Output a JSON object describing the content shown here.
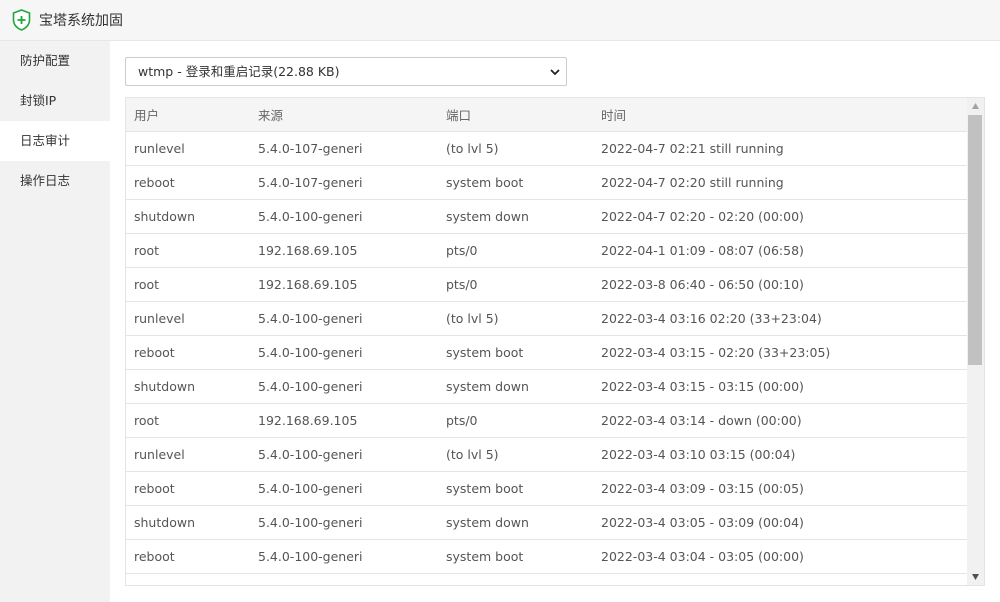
{
  "app": {
    "title": "宝塔系统加固",
    "icon": "shield-plus-icon",
    "accent": "#20a53a"
  },
  "sidebar": {
    "items": [
      {
        "label": "防护配置",
        "active": false
      },
      {
        "label": "封锁IP",
        "active": false
      },
      {
        "label": "日志审计",
        "active": true
      },
      {
        "label": "操作日志",
        "active": false
      }
    ]
  },
  "log_select": {
    "value": "wtmp - 登录和重启记录(22.88 KB)"
  },
  "table": {
    "headers": [
      "用户",
      "来源",
      "端口",
      "时间"
    ],
    "rows": [
      [
        "runlevel",
        "5.4.0-107-generi",
        "(to lvl 5)",
        "2022-04-7 02:21 still running"
      ],
      [
        "reboot",
        "5.4.0-107-generi",
        "system boot",
        "2022-04-7 02:20 still running"
      ],
      [
        "shutdown",
        "5.4.0-100-generi",
        "system down",
        "2022-04-7 02:20 - 02:20 (00:00)"
      ],
      [
        "root",
        "192.168.69.105",
        "pts/0",
        "2022-04-1 01:09 - 08:07 (06:58)"
      ],
      [
        "root",
        "192.168.69.105",
        "pts/0",
        "2022-03-8 06:40 - 06:50 (00:10)"
      ],
      [
        "runlevel",
        "5.4.0-100-generi",
        "(to lvl 5)",
        "2022-03-4 03:16 02:20 (33+23:04)"
      ],
      [
        "reboot",
        "5.4.0-100-generi",
        "system boot",
        "2022-03-4 03:15 - 02:20 (33+23:05)"
      ],
      [
        "shutdown",
        "5.4.0-100-generi",
        "system down",
        "2022-03-4 03:15 - 03:15 (00:00)"
      ],
      [
        "root",
        "192.168.69.105",
        "pts/0",
        "2022-03-4 03:14 - down (00:00)"
      ],
      [
        "runlevel",
        "5.4.0-100-generi",
        "(to lvl 5)",
        "2022-03-4 03:10 03:15 (00:04)"
      ],
      [
        "reboot",
        "5.4.0-100-generi",
        "system boot",
        "2022-03-4 03:09 - 03:15 (00:05)"
      ],
      [
        "shutdown",
        "5.4.0-100-generi",
        "system down",
        "2022-03-4 03:05 - 03:09 (00:04)"
      ],
      [
        "reboot",
        "5.4.0-100-generi",
        "system boot",
        "2022-03-4 03:04 - 03:05 (00:00)"
      ]
    ]
  }
}
